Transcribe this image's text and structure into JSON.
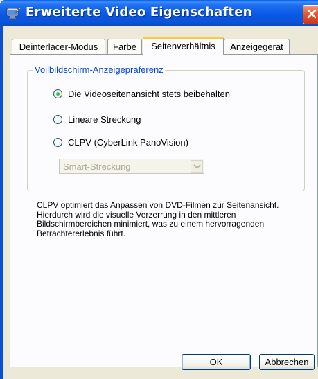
{
  "window": {
    "title": "Erweiterte Video Eigenschaften"
  },
  "tabs": [
    {
      "label": "Deinterlacer-Modus"
    },
    {
      "label": "Farbe"
    },
    {
      "label": "Seitenverhältnis"
    },
    {
      "label": "Anzeigegerät"
    }
  ],
  "active_tab": "Seitenverhältnis",
  "group": {
    "legend": "Vollbildschirm-Anzeigepräferenz",
    "options": [
      {
        "label": "Die Videoseitenansicht stets beibehalten",
        "selected": true
      },
      {
        "label": "Lineare Streckung",
        "selected": false
      },
      {
        "label": "CLPV (CyberLink PanoVision)",
        "selected": false
      }
    ],
    "dropdown": {
      "value": "Smart-Streckung",
      "enabled": false
    }
  },
  "description": "CLPV optimiert das Anpassen von DVD-Filmen zur Seitenansicht. Hierdurch wird die visuelle Verzerrung in den mittleren Bildschirmbereichen minimiert, was zu einem hervorragenden Betrachtererlebnis führt.",
  "buttons": {
    "ok": "OK",
    "cancel": "Abbrechen"
  },
  "icons": {
    "title": "display-settings-icon",
    "close": "close-icon",
    "dropdown": "chevron-down-icon"
  },
  "colors": {
    "titlebar": "#0a55d9",
    "close_button": "#e45a32",
    "active_tab_accent": "#ffc73c",
    "group_legend": "#0046d5",
    "radio_selected": "#21a121"
  }
}
